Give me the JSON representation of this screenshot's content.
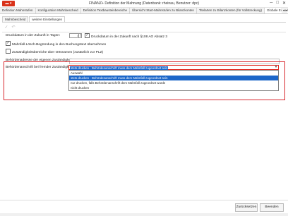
{
  "window": {
    "app_button": "▬ ▾",
    "title": "FINANZ+ Definition der Mahnung (Datenbank: rheinau, Benutzer: dpc)",
    "controls": [
      "─",
      "□",
      "✕"
    ]
  },
  "tabs": [
    "Definition Mahnstufen",
    "Konfiguration Mahnbescheid",
    "Definition Textbausteinbereiche",
    "Übersicht Start-Mahnstufen zu Bilanzkonten",
    "Titelarten zu Bilanzkonten (für Vollstreckung)",
    "Globale Einstellunge"
  ],
  "tab_more": "◂ ▸",
  "subtabs": [
    "Mahnbescheid",
    "weitere Einstellungen"
  ],
  "toolbar": {
    "save_icon": "✓",
    "undo_icon": "↶"
  },
  "form": {
    "druckdatum_label": "Druckdatum in der Zukunft in Tagen:",
    "druckdatum_value": "4",
    "druckdatum_check_label": "Druckdatum in der Zukunft nach §108 AO Absatz 3",
    "mahnfall_label": "Mahnfall-Lösch-Begründung in den Buchungstext übernehmen",
    "zust_label": "Zuständigkeitsbereiche über Ortsnamen (zusätzlich zur PLZ)",
    "eigene_label": "Behördenadresse der eigenen Zuständigkeit:",
    "fremde_label": "Behördenanschrift bei fremder Zuständigkeit:",
    "fremde_selected": "stets drucken - Behördenanschrift muss dem Mahnfall zugeordnet sein",
    "dropdown_options": [
      "Auswahl",
      "stets drucken - Behördenanschrift muss dem Mahnfall zugeordnet sein",
      "nur drucken, falls Behördenanschrift dem Mahnfall zugeordnet wurde",
      "nicht drucken"
    ]
  },
  "footer": {
    "cancel": "Zurücksetzen",
    "close": "Beenden"
  }
}
